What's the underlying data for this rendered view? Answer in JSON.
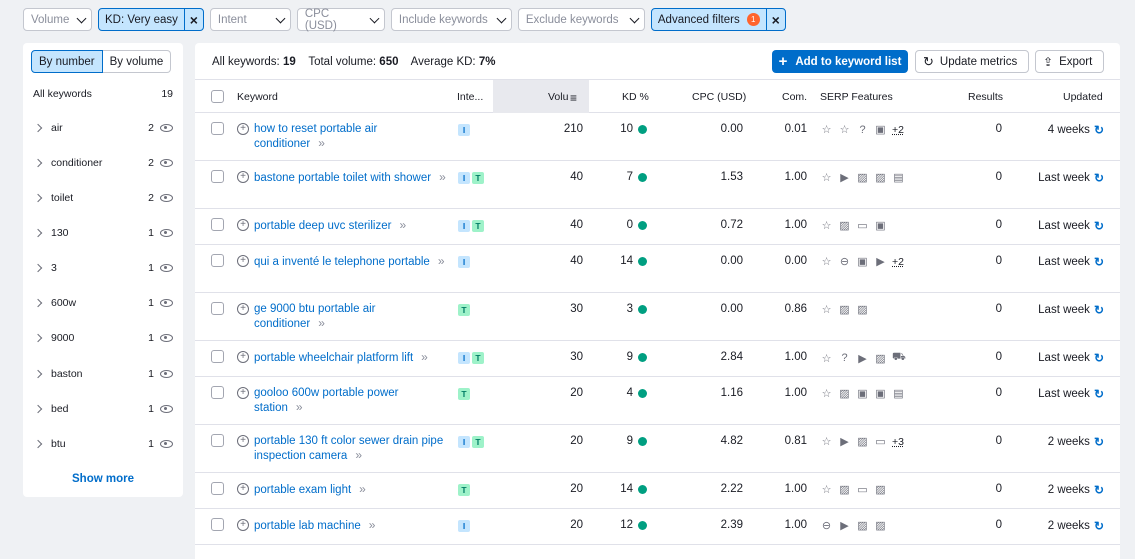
{
  "filters": {
    "volume": "Volume",
    "kd": "KD: Very easy",
    "intent": "Intent",
    "cpc": "CPC (USD)",
    "include": "Include keywords",
    "exclude": "Exclude keywords",
    "advanced": "Advanced filters",
    "advanced_count": "1"
  },
  "sidebar": {
    "by_number": "By number",
    "by_volume": "By volume",
    "all_label": "All keywords",
    "all_count": "19",
    "items": [
      {
        "label": "air",
        "count": "2"
      },
      {
        "label": "conditioner",
        "count": "2"
      },
      {
        "label": "toilet",
        "count": "2"
      },
      {
        "label": "130",
        "count": "1"
      },
      {
        "label": "3",
        "count": "1"
      },
      {
        "label": "600w",
        "count": "1"
      },
      {
        "label": "9000",
        "count": "1"
      },
      {
        "label": "baston",
        "count": "1"
      },
      {
        "label": "bed",
        "count": "1"
      },
      {
        "label": "btu",
        "count": "1"
      }
    ],
    "show_more": "Show more"
  },
  "summary": {
    "all_label": "All keywords:",
    "all_value": "19",
    "volume_label": "Total volume:",
    "volume_value": "650",
    "kd_label": "Average KD:",
    "kd_value": "7%"
  },
  "actions": {
    "add": "Add to keyword list",
    "update": "Update metrics",
    "export": "Export"
  },
  "columns": {
    "keyword": "Keyword",
    "intent": "Inte...",
    "volume": "Volu",
    "kd": "KD %",
    "cpc": "CPC (USD)",
    "com": "Com.",
    "serp": "SERP Features",
    "results": "Results",
    "updated": "Updated"
  },
  "rows": [
    {
      "keyword": "how to reset portable air conditioner",
      "intent": [
        "I"
      ],
      "volume": "210",
      "kd": "10",
      "cpc": "0.00",
      "com": "0.01",
      "serp": [
        "☆",
        "☆",
        "?",
        "▣"
      ],
      "serp_more": "+2",
      "results": "0",
      "updated": "4 weeks"
    },
    {
      "keyword": "bastone portable toilet with shower",
      "intent": [
        "I",
        "T"
      ],
      "volume": "40",
      "kd": "7",
      "cpc": "1.53",
      "com": "1.00",
      "serp": [
        "☆",
        "▶",
        "▨",
        "▨",
        "▤"
      ],
      "serp_more": "",
      "results": "0",
      "updated": "Last week"
    },
    {
      "keyword": "portable deep uvc sterilizer",
      "intent": [
        "I",
        "T"
      ],
      "volume": "40",
      "kd": "0",
      "cpc": "0.72",
      "com": "1.00",
      "serp": [
        "☆",
        "▨",
        "▭",
        "▣"
      ],
      "serp_more": "",
      "results": "0",
      "updated": "Last week"
    },
    {
      "keyword": "qui a inventé le telephone portable",
      "intent": [
        "I"
      ],
      "volume": "40",
      "kd": "14",
      "cpc": "0.00",
      "com": "0.00",
      "serp": [
        "☆",
        "⊖",
        "▣",
        "▶"
      ],
      "serp_more": "+2",
      "results": "0",
      "updated": "Last week"
    },
    {
      "keyword": "ge 9000 btu portable air conditioner",
      "intent": [
        "T"
      ],
      "volume": "30",
      "kd": "3",
      "cpc": "0.00",
      "com": "0.86",
      "serp": [
        "☆",
        "▨",
        "▨"
      ],
      "serp_more": "",
      "results": "0",
      "updated": "Last week"
    },
    {
      "keyword": "portable wheelchair platform lift",
      "intent": [
        "I",
        "T"
      ],
      "volume": "30",
      "kd": "9",
      "cpc": "2.84",
      "com": "1.00",
      "serp": [
        "☆",
        "?",
        "▶",
        "▨",
        "⛟"
      ],
      "serp_more": "",
      "results": "0",
      "updated": "Last week"
    },
    {
      "keyword": "gooloo 600w portable power station",
      "intent": [
        "T"
      ],
      "volume": "20",
      "kd": "4",
      "cpc": "1.16",
      "com": "1.00",
      "serp": [
        "☆",
        "▨",
        "▣",
        "▣",
        "▤"
      ],
      "serp_more": "",
      "results": "0",
      "updated": "Last week"
    },
    {
      "keyword": "portable 130 ft color sewer drain pipe inspection camera",
      "intent": [
        "I",
        "T"
      ],
      "volume": "20",
      "kd": "9",
      "cpc": "4.82",
      "com": "0.81",
      "serp": [
        "☆",
        "▶",
        "▨",
        "▭"
      ],
      "serp_more": "+3",
      "results": "0",
      "updated": "2 weeks"
    },
    {
      "keyword": "portable exam light",
      "intent": [
        "T"
      ],
      "volume": "20",
      "kd": "14",
      "cpc": "2.22",
      "com": "1.00",
      "serp": [
        "☆",
        "▨",
        "▭",
        "▨"
      ],
      "serp_more": "",
      "results": "0",
      "updated": "2 weeks"
    },
    {
      "keyword": "portable lab machine",
      "intent": [
        "I"
      ],
      "volume": "20",
      "kd": "12",
      "cpc": "2.39",
      "com": "1.00",
      "serp": [
        "⊖",
        "▶",
        "▨",
        "▨"
      ],
      "serp_more": "",
      "results": "0",
      "updated": "2 weeks"
    }
  ]
}
